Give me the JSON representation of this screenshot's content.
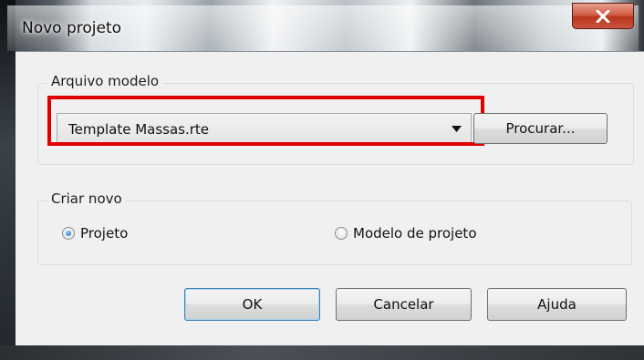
{
  "window": {
    "title": "Novo projeto",
    "close_icon": "close-icon"
  },
  "template_group": {
    "label": "Arquivo modelo",
    "combo_value": "Template Massas.rte",
    "browse_label": "Procurar..."
  },
  "create_group": {
    "label": "Criar novo",
    "options": [
      {
        "label": "Projeto",
        "checked": true
      },
      {
        "label": "Modelo de projeto",
        "checked": false
      }
    ]
  },
  "buttons": {
    "ok": "OK",
    "cancel": "Cancelar",
    "help": "Ajuda"
  },
  "colors": {
    "highlight": "#e00000",
    "close_button": "#c9543e"
  }
}
